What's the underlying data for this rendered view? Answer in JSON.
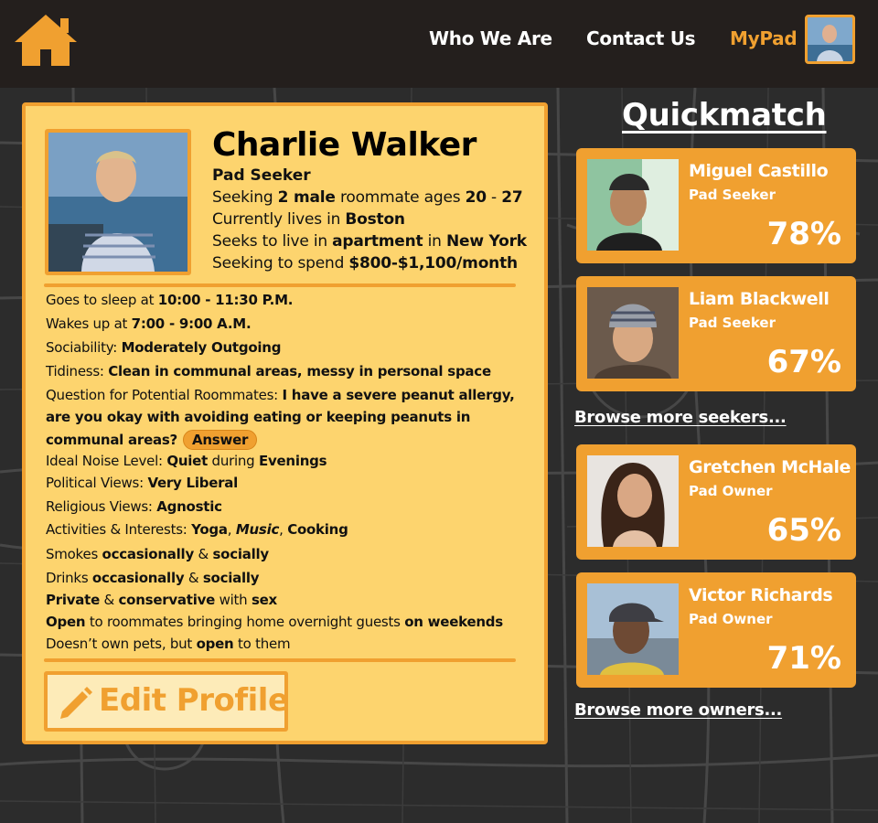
{
  "nav": {
    "home_icon": "house-icon",
    "links": [
      "Who We Are",
      "Contact Us",
      "MyPad"
    ],
    "accent": "#f0a030"
  },
  "profile": {
    "name": "Charlie Walker",
    "role": "Pad Seeker",
    "seeking": {
      "pre": "Seeking ",
      "count": "2 male",
      "mid": " roommate ages ",
      "age_min": "20",
      "dash": " - ",
      "age_max": "27"
    },
    "lives": {
      "pre": "Currently lives in ",
      "city": "Boston"
    },
    "seeks_live": {
      "pre": "Seeks to live in ",
      "type": "apartment",
      "mid": " in ",
      "city": "New York"
    },
    "budget": {
      "pre": "Seeking to spend ",
      "amount": "$800-$1,100/month"
    },
    "details": {
      "sleep": {
        "label": "Goes to sleep at ",
        "value": "10:00 - 11:30 P.M."
      },
      "wake": {
        "label": "Wakes up at ",
        "value": "7:00 - 9:00 A.M."
      },
      "sociability": {
        "label": "Sociability: ",
        "value": "Moderately Outgoing"
      },
      "tidiness": {
        "label": "Tidiness: ",
        "value": "Clean in communal areas, messy in personal space"
      },
      "question": {
        "label": "Question for Potential Roommates: ",
        "line1": "I have a severe peanut allergy,",
        "line2": "are you okay with avoiding eating or keeping peanuts in",
        "line3": "communal areas?",
        "answer_label": "Answer"
      },
      "noise": {
        "label": "Ideal Noise Level: ",
        "level": "Quiet",
        "mid": " during ",
        "time": "Evenings"
      },
      "political": {
        "label": "Political Views: ",
        "value": "Very Liberal"
      },
      "religious": {
        "label": "Religious Views: ",
        "value": "Agnostic"
      },
      "activities": {
        "label": "Activities & Interests: ",
        "a": "Yoga",
        "sep1": ", ",
        "b": "Music",
        "sep2": ", ",
        "c": "Cooking"
      },
      "smokes": {
        "pre": "Smokes ",
        "a": "occasionally",
        "mid": " & ",
        "b": "socially"
      },
      "drinks": {
        "pre": "Drinks ",
        "a": "occasionally",
        "mid": " & ",
        "b": "socially"
      },
      "sex": {
        "a": "Private",
        "mid1": " & ",
        "b": "conservative",
        "mid2": " with ",
        "c": "sex"
      },
      "guests": {
        "a": "Open",
        "mid": " to roommates bringing home overnight guests ",
        "b": "on weekends"
      },
      "pets": {
        "pre": "Doesn’t own pets, but ",
        "a": "open",
        "post": " to them"
      }
    },
    "edit_label": "Edit Profile",
    "edit_icon": "pencil-icon"
  },
  "quickmatch": {
    "title": "Quickmatch",
    "seekers": [
      {
        "name": "Miguel Castillo",
        "role": "Pad Seeker",
        "percent": "78%"
      },
      {
        "name": "Liam Blackwell",
        "role": "Pad Seeker",
        "percent": "67%"
      }
    ],
    "browse_seekers": "Browse more seekers...",
    "owners": [
      {
        "name": "Gretchen McHale",
        "role": "Pad Owner",
        "percent": "65%"
      },
      {
        "name": "Victor Richards",
        "role": "Pad Owner",
        "percent": "71%"
      }
    ],
    "browse_owners": "Browse more owners..."
  }
}
